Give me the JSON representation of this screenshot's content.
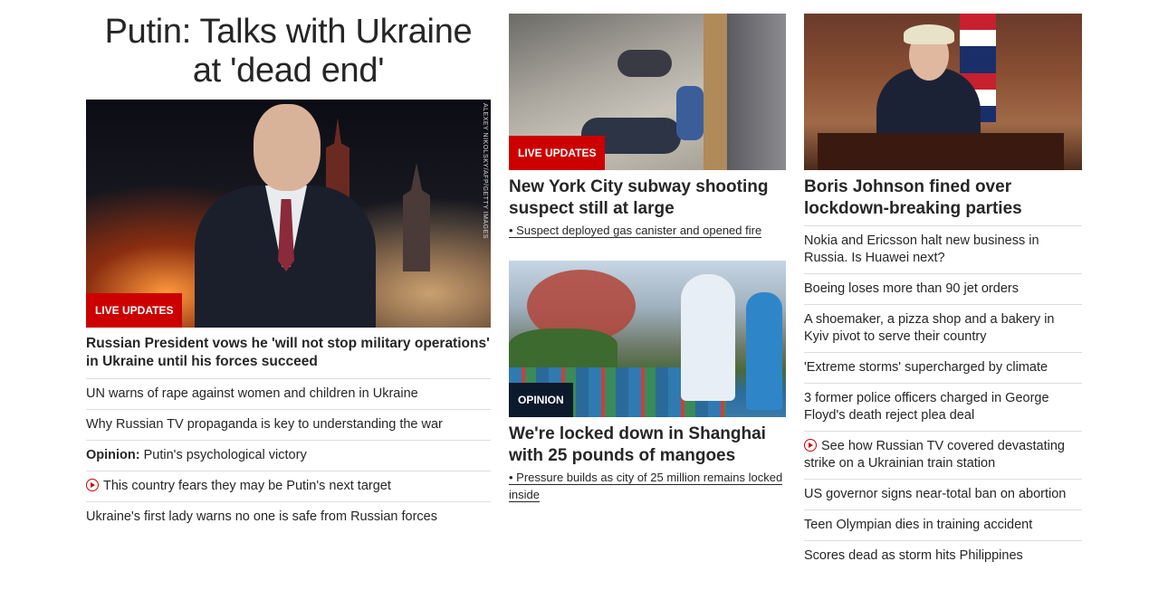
{
  "col1": {
    "headline": "Putin: Talks with Ukraine at 'dead end'",
    "image_credit": "ALEXEY NIKOLSKY/AFP/GETTY IMAGES",
    "badge": "LIVE UPDATES",
    "lead": "Russian President vows he 'will not stop military operations' in Ukraine until his forces succeed",
    "items": [
      "UN warns of rape against women and children in Ukraine",
      "Why Russian TV propaganda is key to understanding the war",
      "Putin's psychological victory",
      "This country fears they may be Putin's next target",
      "Ukraine's first lady warns no one is safe from Russian forces"
    ],
    "opinion_prefix": "Opinion:"
  },
  "col2": {
    "story1": {
      "badge": "LIVE UPDATES",
      "title": "New York City subway shooting suspect still at large",
      "bullet": "• Suspect deployed gas canister and opened fire"
    },
    "story2": {
      "badge": "OPINION",
      "title": "We're locked down in Shanghai with 25 pounds of mangoes",
      "bullet": "• Pressure builds as city of 25 million remains locked inside"
    }
  },
  "col3": {
    "title": "Boris Johnson fined over lockdown-breaking parties",
    "items": [
      "Nokia and Ericsson halt new business in Russia. Is Huawei next?",
      "Boeing loses more than 90 jet orders",
      "A shoemaker, a pizza shop and a bakery in Kyiv pivot to serve their country",
      "'Extreme storms' supercharged by climate",
      "3 former police officers charged in George Floyd's death reject plea deal",
      "See how Russian TV covered devastating strike on a Ukrainian train station",
      "US governor signs near-total ban on abortion",
      "Teen Olympian dies in training accident",
      "Scores dead as storm hits Philippines"
    ]
  },
  "colors": {
    "accent": "#cc0000",
    "opinion_badge": "#0c1a2c",
    "text": "#262626",
    "divider": "#dddddd"
  },
  "icons": {
    "video": "play-circle-icon"
  }
}
